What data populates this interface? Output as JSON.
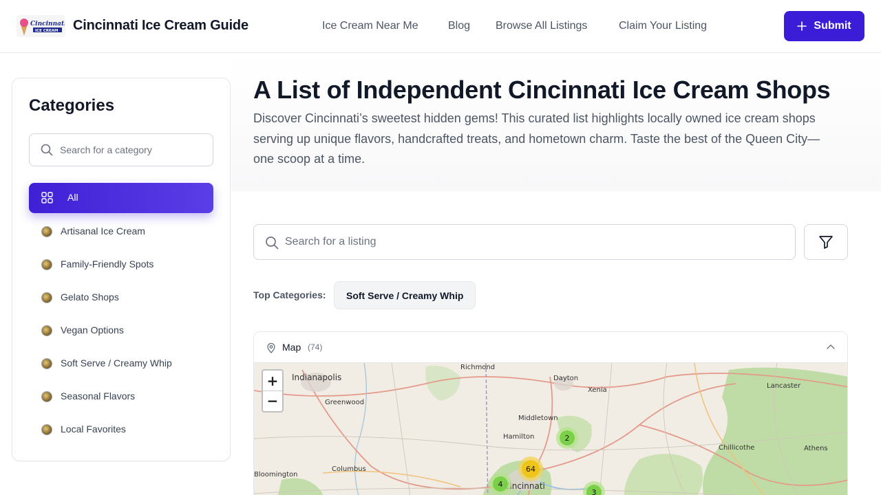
{
  "header": {
    "logo_text": "Cincinnati ICE CREAM",
    "site_title": "Cincinnati Ice Cream Guide",
    "nav": [
      {
        "label": "Ice Cream Near Me"
      },
      {
        "label": "Blog"
      },
      {
        "label": "Browse All Listings"
      },
      {
        "label": "Claim Your Listing"
      }
    ],
    "submit_label": "Submit"
  },
  "sidebar": {
    "title": "Categories",
    "search_placeholder": "Search for a category",
    "all_label": "All",
    "items": [
      {
        "label": "Artisanal Ice Cream"
      },
      {
        "label": "Family-Friendly Spots"
      },
      {
        "label": "Gelato Shops"
      },
      {
        "label": "Vegan Options"
      },
      {
        "label": "Soft Serve / Creamy Whip"
      },
      {
        "label": "Seasonal Flavors"
      },
      {
        "label": "Local Favorites"
      }
    ]
  },
  "hero": {
    "title": "A List of Independent Cincinnati Ice Cream Shops",
    "description": "Discover Cincinnati’s sweetest hidden gems! This curated list highlights locally owned ice cream shops serving up unique flavors, handcrafted treats, and hometown charm. Taste the best of the Queen City—one scoop at a time."
  },
  "listing_search": {
    "placeholder": "Search for a listing"
  },
  "top_categories": {
    "label": "Top Categories:",
    "chips": [
      {
        "label": "Soft Serve / Creamy Whip"
      }
    ]
  },
  "map": {
    "title": "Map",
    "count": "(74)",
    "zoom_in": "+",
    "zoom_out": "−",
    "cities": [
      {
        "name": "Indianapolis"
      },
      {
        "name": "Richmond"
      },
      {
        "name": "Dayton"
      },
      {
        "name": "Xenia"
      },
      {
        "name": "Lancaster"
      },
      {
        "name": "Greenwood"
      },
      {
        "name": "Middletown"
      },
      {
        "name": "Hamilton"
      },
      {
        "name": "Chillicothe"
      },
      {
        "name": "Athens"
      },
      {
        "name": "Columbus"
      },
      {
        "name": "Bloomington"
      },
      {
        "name": "Cincinnati"
      }
    ],
    "clusters": [
      {
        "count": "2",
        "color": "#6ecc39"
      },
      {
        "count": "64",
        "color": "#f0c20c"
      },
      {
        "count": "4",
        "color": "#6ecc39"
      },
      {
        "count": "3",
        "color": "#6ecc39"
      }
    ]
  },
  "colors": {
    "primary": "#3b1dd8",
    "border": "#e5e7eb",
    "text_muted": "#4b5563"
  }
}
